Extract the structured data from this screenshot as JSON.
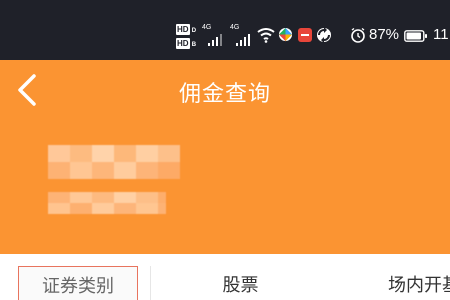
{
  "status_bar": {
    "hd_top": "HD",
    "hd_top_sub": "D",
    "hd_bottom": "HD",
    "hd_bottom_sub": "B",
    "net1": "4G",
    "net2": "4G",
    "battery_pct": "87%",
    "time_partial": "11",
    "colors": {
      "bg": "#1f2129",
      "icon": "#ffffff"
    }
  },
  "header": {
    "title": "佣金查询",
    "back_icon": "chevron-left-icon",
    "color": "#fb9432"
  },
  "table": {
    "headers": [
      "证券类别",
      "股票",
      "场内开基"
    ]
  }
}
